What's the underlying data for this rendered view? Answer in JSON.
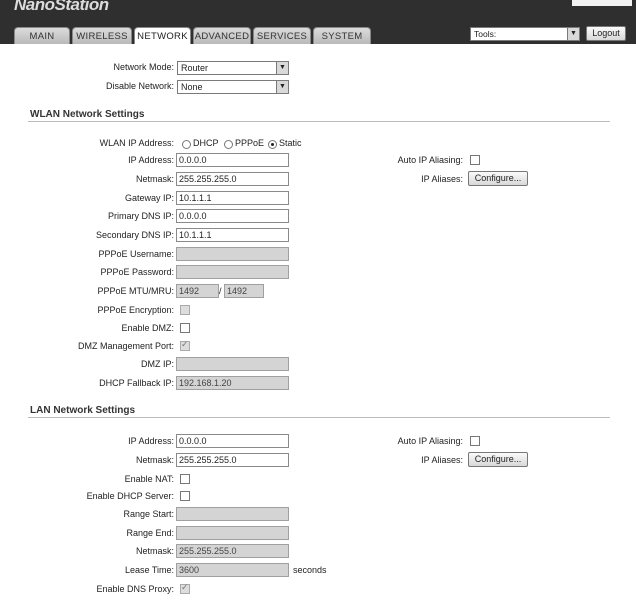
{
  "header": {
    "brand": "NanoStation",
    "brand_right": ""
  },
  "tabs": [
    "MAIN",
    "WIRELESS",
    "NETWORK",
    "ADVANCED",
    "SERVICES",
    "SYSTEM"
  ],
  "toolbar": {
    "tools_value": "Tools:",
    "logout_label": "Logout"
  },
  "top": {
    "network_mode_label": "Network Mode:",
    "network_mode_value": "Router",
    "disable_network_label": "Disable Network:",
    "disable_network_value": "None"
  },
  "wlan": {
    "title": "WLAN Network Settings",
    "ip_mode_label": "WLAN IP Address:",
    "ip_modes": [
      "DHCP",
      "PPPoE",
      "Static"
    ],
    "selected_mode": "Static",
    "ip_label": "IP Address:",
    "ip_value": "0.0.0.0",
    "netmask_label": "Netmask:",
    "netmask_value": "255.255.255.0",
    "gateway_label": "Gateway IP:",
    "gateway_value": "10.1.1.1",
    "pdns_label": "Primary DNS IP:",
    "pdns_value": "0.0.0.0",
    "sdns_label": "Secondary DNS IP:",
    "sdns_value": "10.1.1.1",
    "pppoe_user_label": "PPPoE Username:",
    "pppoe_user_value": "",
    "pppoe_pass_label": "PPPoE Password:",
    "pppoe_pass_value": "",
    "mtu_label": "PPPoE MTU/MRU:",
    "mtu_value": "1492",
    "mtu_sep": "/",
    "mru_value": "1492",
    "pppoe_enc_label": "PPPoE Encryption:",
    "dmz_label": "Enable DMZ:",
    "dmz_mgmt_label": "DMZ Management Port:",
    "dmz_ip_label": "DMZ IP:",
    "dmz_ip_value": "",
    "dhcp_fallback_label": "DHCP Fallback IP:",
    "dhcp_fallback_value": "192.168.1.20",
    "auto_alias_label": "Auto IP Aliasing:",
    "ip_aliases_label": "IP Aliases:",
    "configure_label": "Configure..."
  },
  "lan": {
    "title": "LAN Network Settings",
    "ip_label": "IP Address:",
    "ip_value": "0.0.0.0",
    "netmask_label": "Netmask:",
    "netmask_value": "255.255.255.0",
    "nat_label": "Enable NAT:",
    "dhcp_server_label": "Enable DHCP Server:",
    "range_start_label": "Range Start:",
    "range_start_value": "",
    "range_end_label": "Range End:",
    "range_end_value": "",
    "dhcp_netmask_label": "Netmask:",
    "dhcp_netmask_value": "255.255.255.0",
    "lease_label": "Lease Time:",
    "lease_value": "3600",
    "lease_unit": "seconds",
    "dns_proxy_label": "Enable DNS Proxy:",
    "auto_alias_label": "Auto IP Aliasing:",
    "ip_aliases_label": "IP Aliases:",
    "configure_label": "Configure..."
  }
}
